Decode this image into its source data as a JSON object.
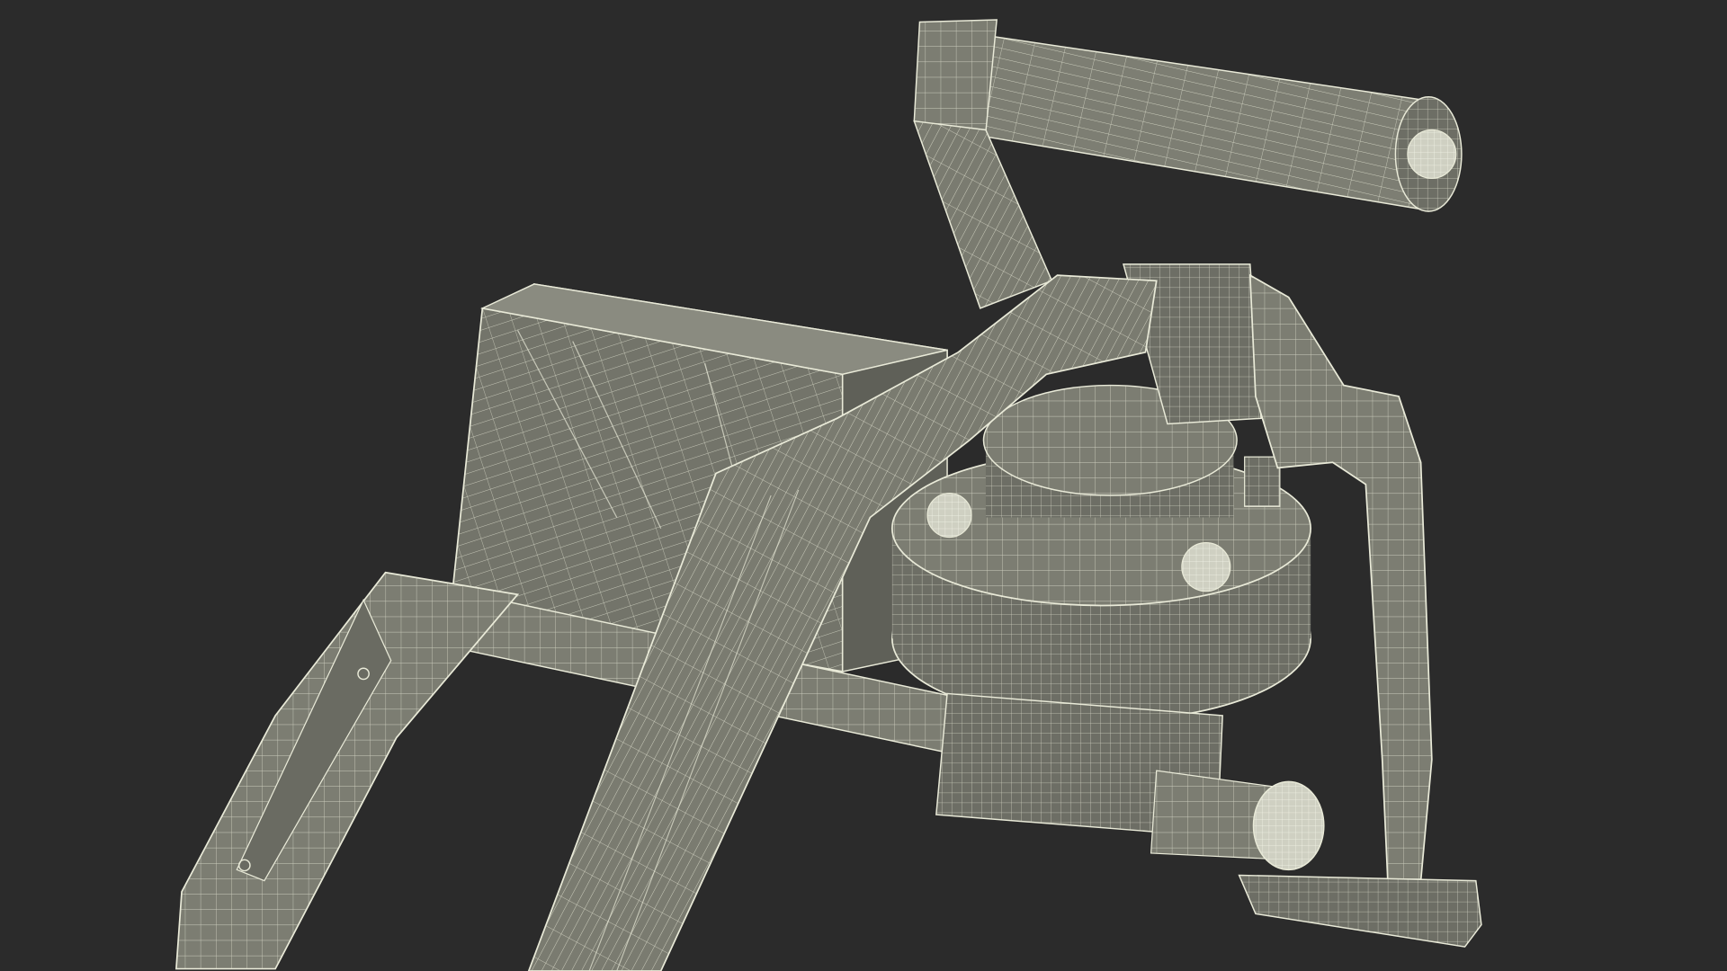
{
  "scene": {
    "background_color": "#2b2b2b",
    "mesh_fill_color": "#7c7d72",
    "mesh_shadow_color": "#5f6058",
    "mesh_highlight_color": "#92938a",
    "wire_color": "#e9ead8"
  }
}
